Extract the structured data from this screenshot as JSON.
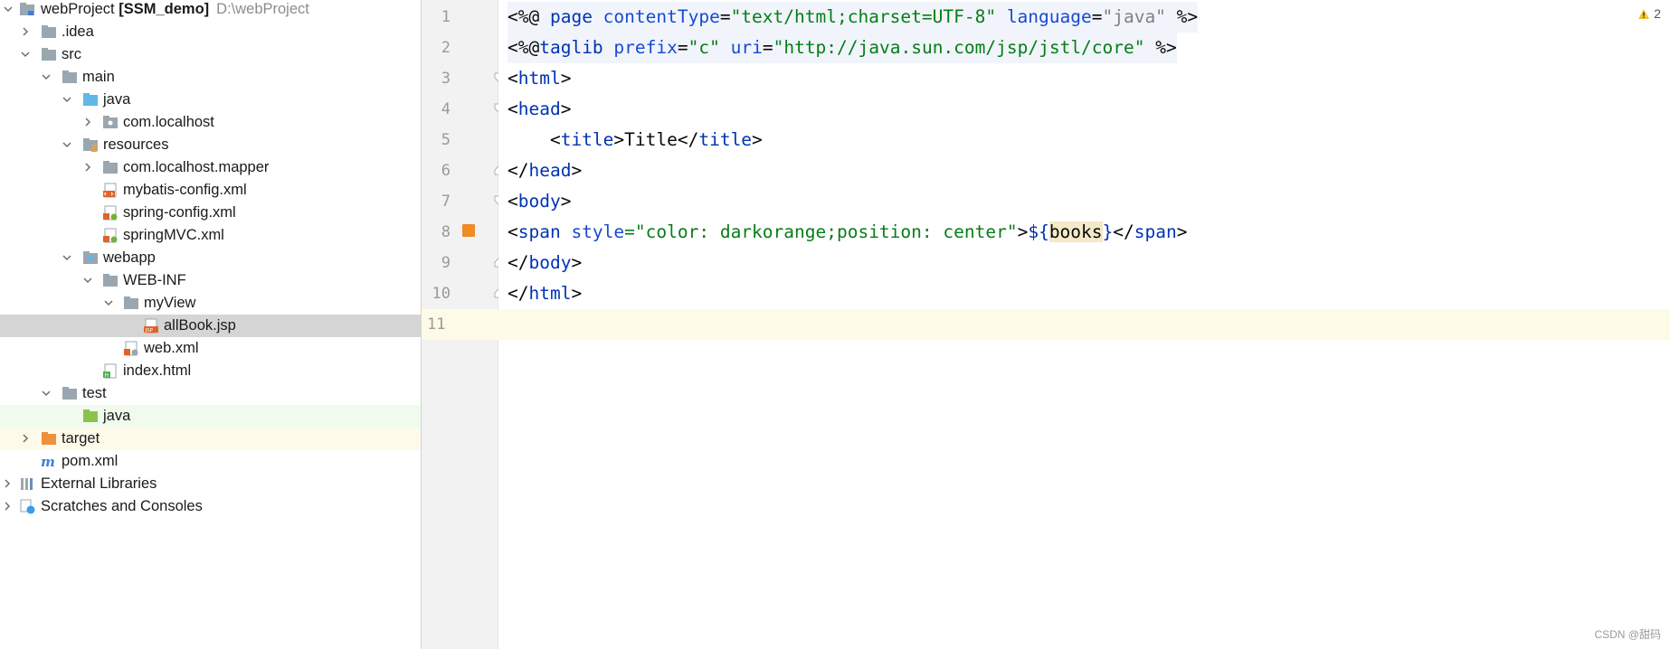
{
  "project_tree": {
    "root": {
      "name": "webProject",
      "module": "[SSM_demo]",
      "path": "D:\\webProject"
    },
    "items": [
      {
        "label": "webProject",
        "kind": "root"
      },
      {
        "label": ".idea",
        "kind": "folder"
      },
      {
        "label": "src",
        "kind": "folder"
      },
      {
        "label": "main",
        "kind": "folder"
      },
      {
        "label": "java",
        "kind": "source-folder"
      },
      {
        "label": "com.localhost",
        "kind": "package"
      },
      {
        "label": "resources",
        "kind": "resources-folder"
      },
      {
        "label": "com.localhost.mapper",
        "kind": "folder"
      },
      {
        "label": "mybatis-config.xml",
        "kind": "xml-file"
      },
      {
        "label": "spring-config.xml",
        "kind": "spring-xml-file"
      },
      {
        "label": "springMVC.xml",
        "kind": "spring-xml-file"
      },
      {
        "label": "webapp",
        "kind": "web-folder"
      },
      {
        "label": "WEB-INF",
        "kind": "folder"
      },
      {
        "label": "myView",
        "kind": "folder"
      },
      {
        "label": "allBook.jsp",
        "kind": "jsp-file"
      },
      {
        "label": "web.xml",
        "kind": "web-xml-file"
      },
      {
        "label": "index.html",
        "kind": "html-file"
      },
      {
        "label": "test",
        "kind": "folder"
      },
      {
        "label": "java",
        "kind": "test-source-folder"
      },
      {
        "label": "target",
        "kind": "excluded-folder"
      },
      {
        "label": "pom.xml",
        "kind": "maven-file"
      },
      {
        "label": "External Libraries",
        "kind": "libraries"
      },
      {
        "label": "Scratches and Consoles",
        "kind": "scratches"
      }
    ],
    "selected": "allBook.jsp"
  },
  "editor": {
    "line_numbers": [
      "1",
      "2",
      "3",
      "4",
      "5",
      "6",
      "7",
      "8",
      "9",
      "10",
      "11"
    ],
    "lines": [
      [
        "<%@ ",
        "page ",
        "contentType",
        "=",
        "\"text/html;charset=UTF-8\"",
        " ",
        "language",
        "=",
        "\"java\"",
        " %>"
      ],
      [
        "<%@",
        "taglib ",
        "prefix",
        "=",
        "\"c\"",
        " ",
        "uri",
        "=",
        "\"http://java.sun.com/jsp/jstl/core\"",
        " %>"
      ],
      [
        "<",
        "html",
        ">"
      ],
      [
        "<",
        "head",
        ">"
      ],
      [
        "    <",
        "title",
        ">",
        "Title",
        "</",
        "title",
        ">"
      ],
      [
        "</",
        "head",
        ">"
      ],
      [
        "<",
        "body",
        ">"
      ],
      [
        "<",
        "span ",
        "style",
        "=",
        "\"color: ",
        "darkorange",
        ";position: ",
        "center",
        "\"",
        ">",
        "${",
        "books",
        "}",
        "</",
        "span",
        ">"
      ],
      [
        "</",
        "body",
        ">"
      ],
      [
        "</",
        "html",
        ">"
      ],
      []
    ],
    "warning_count": "2",
    "watermark": "CSDN @甜码"
  },
  "colors": {
    "tag": "#0033b3",
    "attribute": "#174ad4",
    "string": "#067d17",
    "selection_row": "#d5d5d5",
    "current_line": "#fdfbe8",
    "breakpoint": "#f08a24"
  }
}
